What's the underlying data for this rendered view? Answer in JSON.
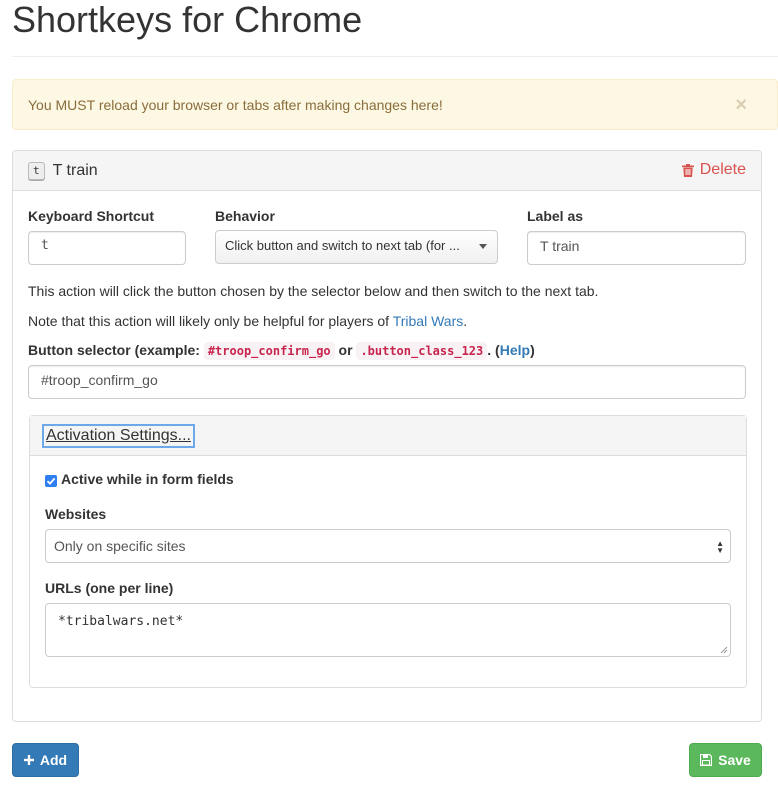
{
  "page": {
    "title": "Shortkeys for Chrome"
  },
  "alert": {
    "message": "You MUST reload your browser or tabs after making changes here!",
    "close_glyph": "×"
  },
  "shortcut": {
    "key_badge": "t",
    "heading_title": "T train",
    "delete_label": "Delete",
    "keyboard_shortcut_label": "Keyboard Shortcut",
    "keyboard_shortcut_value": "t",
    "behavior_label": "Behavior",
    "behavior_value": "Click button and switch to next tab (for ...",
    "label_as_label": "Label as",
    "label_as_value": "T train",
    "description_line1": "This action will click the button chosen by the selector below and then switch to the next tab.",
    "description_line2_prefix": "Note that this action will likely only be helpful for players of ",
    "description_line2_link": "Tribal Wars",
    "description_line2_suffix": ".",
    "selector_label_prefix": "Button selector (example: ",
    "selector_example_1": "#troop_confirm_go",
    "selector_label_or": " or ",
    "selector_example_2": ".button_class_123",
    "selector_label_mid": ". (",
    "selector_help_link": "Help",
    "selector_label_suffix": ")",
    "selector_value": "#troop_confirm_go"
  },
  "activation": {
    "heading": "Activation Settings...",
    "active_in_form_fields_label": "Active while in form fields",
    "active_in_form_fields_checked": true,
    "websites_label": "Websites",
    "websites_value": "Only on specific sites",
    "urls_label": "URLs (one per line)",
    "urls_value": "*tribalwars.net*"
  },
  "footer": {
    "add_label": "Add",
    "save_label": "Save"
  },
  "colors": {
    "primary": "#337ab7",
    "success": "#5cb85c",
    "danger": "#d9534f",
    "warning_bg": "#fcf8e3",
    "warning_text": "#8a6d3b"
  },
  "icons": {
    "delete": "trash-icon",
    "add": "plus-icon",
    "save": "floppy-disk-icon",
    "close": "close-icon",
    "checkbox": "checkmark-icon",
    "behavior_caret": "caret-down-icon",
    "websites_arrows": "select-arrows-icon"
  }
}
